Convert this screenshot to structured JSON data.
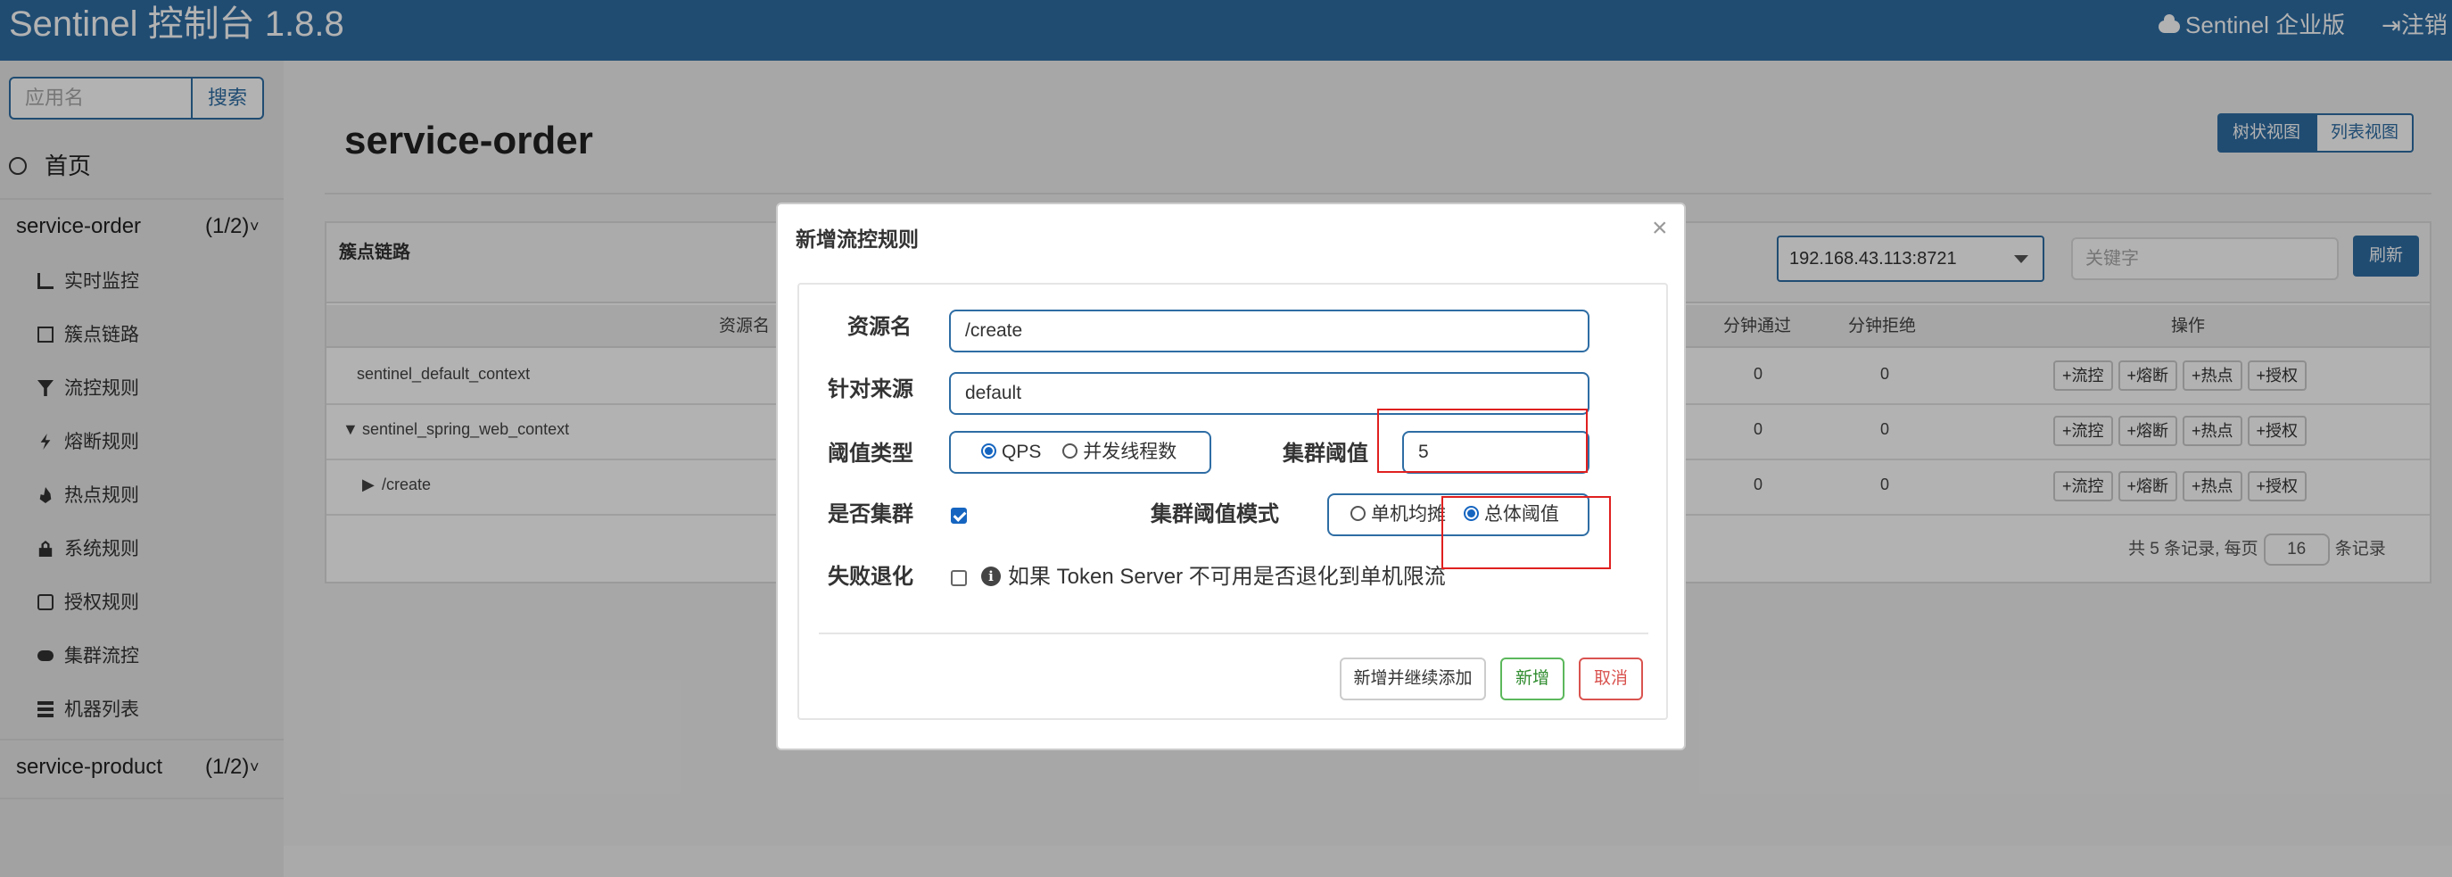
{
  "header": {
    "brand": "Sentinel 控制台 1.8.8",
    "enterprise": "Sentinel 企业版",
    "logout": "注销"
  },
  "sidebar": {
    "search_placeholder": "应用名",
    "search_button": "搜索",
    "home": "首页",
    "apps": [
      {
        "name": "service-order",
        "count": "(1/2)"
      },
      {
        "name": "service-product",
        "count": "(1/2)"
      }
    ],
    "menu": [
      "实时监控",
      "簇点链路",
      "流控规则",
      "熔断规则",
      "热点规则",
      "系统规则",
      "授权规则",
      "集群流控",
      "机器列表"
    ]
  },
  "main": {
    "title": "service-order",
    "view_tree": "树状视图",
    "view_list": "列表视图",
    "panel_title": "簇点链路",
    "machine": "192.168.43.113:8721",
    "keyword_placeholder": "关键字",
    "refresh": "刷新",
    "columns": {
      "resource": "资源名",
      "pass_min": "分钟通过",
      "block_min": "分钟拒绝",
      "ops": "操作"
    },
    "rows": [
      {
        "name": "sentinel_default_context",
        "pass": "0",
        "block": "0"
      },
      {
        "name": "sentinel_spring_web_context",
        "pass": "0",
        "block": "0"
      },
      {
        "name": "/create",
        "pass": "0",
        "block": "0"
      }
    ],
    "op_buttons": [
      "+流控",
      "+熔断",
      "+热点",
      "+授权"
    ],
    "pager": {
      "prefix": "共 5 条记录, 每页",
      "size": "16",
      "suffix": "条记录"
    }
  },
  "modal": {
    "title": "新增流控规则",
    "close": "×",
    "labels": {
      "resource": "资源名",
      "origin": "针对来源",
      "threshold_type": "阈值类型",
      "cluster_threshold": "集群阈值",
      "is_cluster": "是否集群",
      "cluster_mode": "集群阈值模式",
      "fallback": "失败退化"
    },
    "values": {
      "resource": "/create",
      "origin": "default",
      "cluster_threshold": "5"
    },
    "threshold_options": [
      "QPS",
      "并发线程数"
    ],
    "cluster_mode_options": [
      "单机均摊",
      "总体阈值"
    ],
    "fallback_text": "如果 Token Server 不可用是否退化到单机限流",
    "buttons": {
      "save_continue": "新增并继续添加",
      "add": "新增",
      "cancel": "取消"
    }
  }
}
